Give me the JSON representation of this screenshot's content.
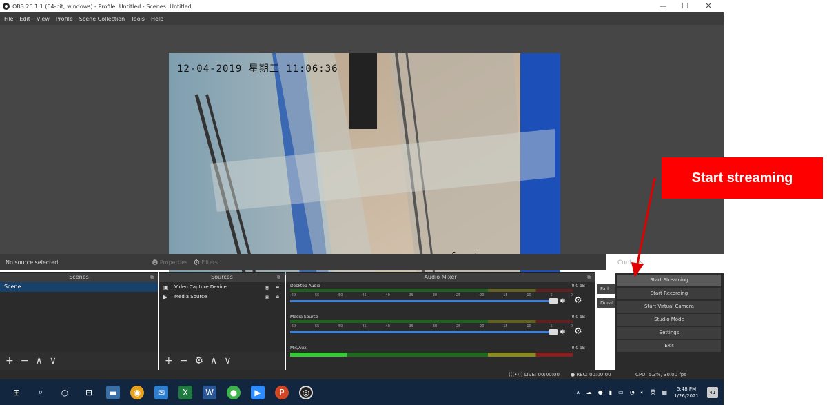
{
  "window": {
    "title": "OBS 26.1.1 (64-bit, windows) - Profile: Untitled - Scenes: Untitled",
    "minimize": "—",
    "maximize": "☐",
    "close": "✕"
  },
  "menu": [
    "File",
    "Edit",
    "View",
    "Profile",
    "Scene Collection",
    "Tools",
    "Help"
  ],
  "preview": {
    "timestamp": "12-04-2019 星期三 11:06:36",
    "camera_label": "front"
  },
  "source_bar": {
    "status": "No source selected",
    "properties": "Properties",
    "filters": "Filters"
  },
  "controls_search": "Controls",
  "scenes": {
    "header": "Scenes",
    "items": [
      "Scene"
    ]
  },
  "sources": {
    "header": "Sources",
    "items": [
      {
        "name": "Video Capture Device",
        "icon": "camera-icon"
      },
      {
        "name": "Media Source",
        "icon": "play-icon"
      }
    ]
  },
  "mixer": {
    "header": "Audio Mixer",
    "channels": [
      {
        "name": "Desktop Audio",
        "db": "0.0 dB"
      },
      {
        "name": "Media Source",
        "db": "0.0 dB"
      },
      {
        "name": "Mic/Aux",
        "db": "0.0 dB"
      }
    ],
    "ticks": [
      "-60",
      "-55",
      "-50",
      "-45",
      "-40",
      "-35",
      "-30",
      "-25",
      "-20",
      "-15",
      "-10",
      "-5",
      "0"
    ]
  },
  "transitions": [
    "Fad",
    "Durat"
  ],
  "controls": {
    "items": [
      "Start Streaming",
      "Start Recording",
      "Start Virtual Camera",
      "Studio Mode",
      "Settings",
      "Exit"
    ]
  },
  "status": {
    "live": "(((•))) LIVE: 00:00:00",
    "rec": "● REC: 00:00:00",
    "cpu": "CPU: 5.3%, 30.00 fps"
  },
  "taskbar": {
    "tray_lang": "英",
    "time": "5:48 PM",
    "date": "1/26/2021",
    "notifications": "41"
  },
  "annotation": {
    "callout": "Start streaming",
    "color": "#ff0000"
  }
}
